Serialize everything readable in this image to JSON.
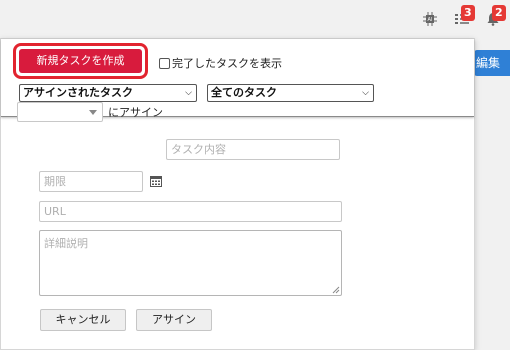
{
  "topbar": {
    "icons": [
      {
        "name": "chip-icon"
      },
      {
        "name": "task-list-icon",
        "badge": "3"
      },
      {
        "name": "bell-icon",
        "badge": "2"
      }
    ]
  },
  "background": {
    "blue_button_label": "編集"
  },
  "panel": {
    "create_button_label": "新規タスクを作成",
    "show_completed_label": "完了したタスクを表示",
    "filter_assigned": "アサインされたタスク",
    "filter_status": "全てのタスク"
  },
  "form": {
    "assignee_value": "",
    "assign_to_label": "にアサイン",
    "task_content_placeholder": "タスク内容",
    "deadline_placeholder": "期限",
    "url_placeholder": "URL",
    "details_placeholder": "詳細説明",
    "cancel_label": "キャンセル",
    "assign_label": "アサイン"
  },
  "colors": {
    "create_button": "#d81b3d",
    "highlight_border": "#e2242f",
    "badge": "#e53935",
    "blue_button": "#2f80d6"
  }
}
